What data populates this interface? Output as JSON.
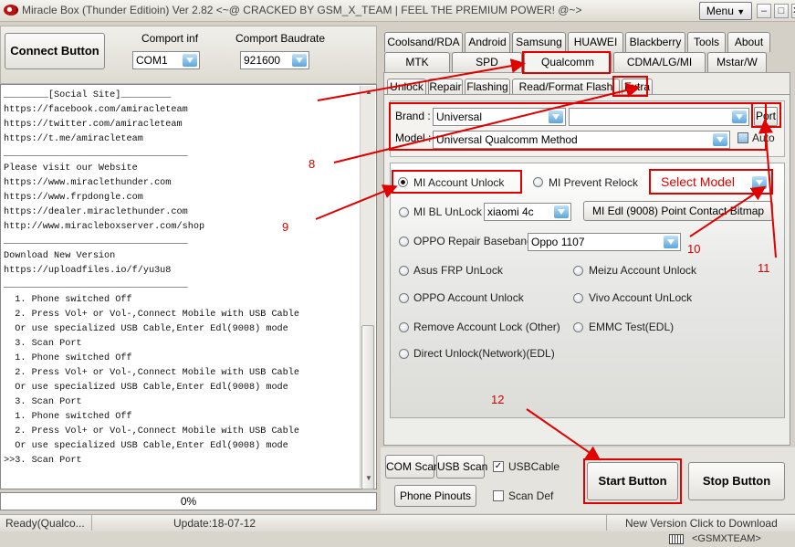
{
  "window": {
    "title": "Miracle Box (Thunder Editioin) Ver 2.82 <~@ CRACKED BY GSM_X_TEAM | FEEL THE PREMIUM POWER! @~>",
    "menu_label": "Menu",
    "menu_arrow": "▼",
    "minimize": "–",
    "maximize": "□",
    "close": "✕"
  },
  "connection": {
    "connect_label": "Connect Button",
    "comport_label": "Comport inf",
    "comport_value": "COM1",
    "baud_label": "Comport Baudrate",
    "baud_value": "921600"
  },
  "log": {
    "lines": [
      "________[Social Site]_________",
      "https://facebook.com/amiracleteam",
      "https://twitter.com/amiracleteam",
      "https://t.me/amiracleteam",
      "_________________________________",
      "Please visit our Website",
      "https://www.miraclethunder.com",
      "https://www.frpdongle.com",
      "https://dealer.miraclethunder.com",
      "http://www.miracleboxserver.com/shop",
      "_________________________________",
      "Download New Version",
      "https://uploadfiles.io/f/yu3u8",
      "_________________________________",
      "  1. Phone switched Off",
      "  2. Press Vol+ or Vol-,Connect Mobile with USB Cable",
      "  Or use specialized USB Cable,Enter Edl(9008) mode",
      "  3. Scan Port",
      "  1. Phone switched Off",
      "  2. Press Vol+ or Vol-,Connect Mobile with USB Cable",
      "  Or use specialized USB Cable,Enter Edl(9008) mode",
      "  3. Scan Port",
      "  1. Phone switched Off",
      "  2. Press Vol+ or Vol-,Connect Mobile with USB Cable",
      "  Or use specialized USB Cable,Enter Edl(9008) mode",
      ">>3. Scan Port"
    ],
    "progress_text": "0%",
    "progress_value": 0
  },
  "tabs_row1": [
    "Coolsand/RDA",
    "Android",
    "Samsung",
    "HUAWEI",
    "Blackberry",
    "Tools",
    "About"
  ],
  "tabs_row2": [
    "MTK",
    "SPD",
    "Qualcomm",
    "CDMA/LG/MI",
    "Mstar/W"
  ],
  "subtabs": [
    "Unlock",
    "Repair",
    "Flashing",
    "Read/Format Flash",
    "Extra"
  ],
  "selected_tab": "Qualcomm",
  "selected_subtab": "Extra",
  "brand": {
    "label": "Brand :",
    "value": "Universal",
    "second_value": ""
  },
  "model": {
    "label": "Model :",
    "value": "Universal Qualcomm Method"
  },
  "port_button": "Port",
  "auto_label": "Auto",
  "options": {
    "mi_account_unlock": "MI Account Unlock",
    "mi_prevent_relock": "MI Prevent Relock",
    "select_model": "Select Model",
    "mi_bl_unlock": "MI BL UnLock",
    "mi_bl_model": "xiaomi 4c",
    "mi_edl_button": "MI Edl (9008) Point Contact Bitmap",
    "oppo_repair_baseband": "OPPO Repair Baseband",
    "oppo_model": "Oppo 1107",
    "asus_frp": "Asus FRP UnLock",
    "meizu_account": "Meizu Account Unlock",
    "oppo_account": "OPPO Account Unlock",
    "vivo_account": "Vivo Account UnLock",
    "remove_account_lock": "Remove Account Lock (Other)",
    "emmc_test": "EMMC Test(EDL)",
    "direct_unlock": "Direct Unlock(Network)(EDL)"
  },
  "bottom": {
    "com_scan": "COM Scan",
    "usb_scan": "USB Scan",
    "usb_cable": "USBCable",
    "usb_cable_checked": true,
    "phone_pinouts": "Phone Pinouts",
    "scan_def": "Scan Def",
    "scan_def_checked": false,
    "start": "Start Button",
    "stop": "Stop Button"
  },
  "status": {
    "left": "Ready(Qualco...",
    "update": "Update:18-07-12",
    "new_version": "New Version Click to Download",
    "team": "<GSMXTEAM>"
  },
  "annotations": {
    "a8": "8",
    "a9": "9",
    "a10": "10",
    "a11": "11",
    "a12": "12"
  },
  "colors": {
    "annotation_red": "#e00000",
    "arrow_blue": "#5aa6dc"
  }
}
